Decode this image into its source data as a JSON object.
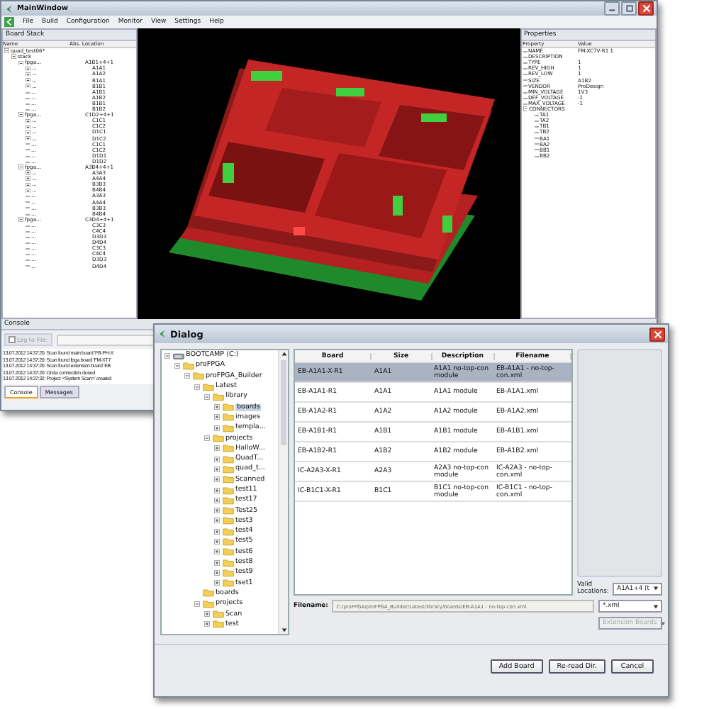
{
  "main_window": {
    "title": "MainWindow",
    "menu": [
      "File",
      "Build",
      "Configuration",
      "Monitor",
      "View",
      "Settings",
      "Help"
    ],
    "board_stack": {
      "title": "Board Stack",
      "columns": [
        "Name",
        "Abs. Location"
      ],
      "tree": [
        {
          "name": "quad_test06*",
          "expanded": true,
          "children": [
            {
              "name": "stack",
              "expanded": true,
              "children": [
                {
                  "name": "fpga...",
                  "location": "A1B1+4+1",
                  "expanded": true,
                  "children": [
                    {
                      "name": "...",
                      "location": "A1A1",
                      "expanded": false
                    },
                    {
                      "name": "...",
                      "location": "A1A2",
                      "expanded": false
                    },
                    {
                      "name": "...",
                      "location": "B1A1",
                      "expanded": false
                    },
                    {
                      "name": "...",
                      "location": "B1B1",
                      "expanded": false
                    },
                    {
                      "name": "...",
                      "location": "A1B1"
                    },
                    {
                      "name": "...",
                      "location": "A1B2"
                    },
                    {
                      "name": "...",
                      "location": "B1B1"
                    },
                    {
                      "name": "...",
                      "location": "B1B2"
                    }
                  ]
                },
                {
                  "name": "fpga...",
                  "location": "C1D2+4+1",
                  "expanded": true,
                  "children": [
                    {
                      "name": "...",
                      "location": "C1C1",
                      "expanded": false
                    },
                    {
                      "name": "...",
                      "location": "C1C2",
                      "expanded": false
                    },
                    {
                      "name": "...",
                      "location": "D1C1",
                      "expanded": false
                    },
                    {
                      "name": "...",
                      "location": "D1C2",
                      "expanded": false
                    },
                    {
                      "name": "...",
                      "location": "C1C1"
                    },
                    {
                      "name": "...",
                      "location": "C1C2"
                    },
                    {
                      "name": "...",
                      "location": "D1D1"
                    },
                    {
                      "name": "...",
                      "location": "D1D2"
                    }
                  ]
                },
                {
                  "name": "fpga...",
                  "location": "A3B4+4+1",
                  "expanded": true,
                  "children": [
                    {
                      "name": "...",
                      "location": "A3A3",
                      "expanded": false
                    },
                    {
                      "name": "...",
                      "location": "A4A4",
                      "expanded": false
                    },
                    {
                      "name": "...",
                      "location": "B3B3",
                      "expanded": false
                    },
                    {
                      "name": "...",
                      "location": "B4B4",
                      "expanded": false
                    },
                    {
                      "name": "...",
                      "location": "A3A3"
                    },
                    {
                      "name": "...",
                      "location": "A4A4"
                    },
                    {
                      "name": "...",
                      "location": "B3B3"
                    },
                    {
                      "name": "...",
                      "location": "B4B4"
                    }
                  ]
                },
                {
                  "name": "fpga...",
                  "location": "C3D4+4+1",
                  "expanded": true,
                  "children": [
                    {
                      "name": "...",
                      "location": "C3C3"
                    },
                    {
                      "name": "...",
                      "location": "C4C4"
                    },
                    {
                      "name": "...",
                      "location": "D3D3"
                    },
                    {
                      "name": "...",
                      "location": "D4D4"
                    },
                    {
                      "name": "...",
                      "location": "C3C3"
                    },
                    {
                      "name": "...",
                      "location": "C4C4"
                    },
                    {
                      "name": "...",
                      "location": "D3D3"
                    },
                    {
                      "name": "...",
                      "location": "D4D4"
                    }
                  ]
                }
              ]
            }
          ]
        }
      ]
    },
    "properties": {
      "title": "Properties",
      "columns": [
        "Property",
        "Value"
      ],
      "rows": [
        {
          "name": "NAME",
          "value": "FM-XC7V-R1 1"
        },
        {
          "name": "DESCRIPTION"
        },
        {
          "name": "TYPE",
          "value": "1"
        },
        {
          "name": "REV_HIGH",
          "value": "1"
        },
        {
          "name": "REV_LOW",
          "value": "1"
        },
        {
          "name": "SIZE",
          "value": "A1B2"
        },
        {
          "name": "VENDOR",
          "value": "ProDesign"
        },
        {
          "name": "MIN_VOLTAGE",
          "value": "1V3"
        },
        {
          "name": "DEF_VOLTAGE",
          "value": "-1"
        },
        {
          "name": "MAX_VOLTAGE",
          "value": "-1"
        },
        {
          "name": "CONNECTORS",
          "expanded": true,
          "children": [
            "TA1",
            "TA2",
            "TB1",
            "TB2",
            "BA1",
            "BA2",
            "BB1",
            "BB2"
          ]
        }
      ]
    },
    "console": {
      "title": "Console",
      "log_to_file": {
        "label": "Log to File:",
        "checked": false,
        "disabled": true
      },
      "lines": [
        "13.07.2012 14:37:20: Scan found main board 'FB-PH-X",
        "13.07.2012 14:37:20: Scan found fpga board 'FM-XT7",
        "13.07.2012 14:37:20: Scan found extension board 'EB",
        "13.07.2012 14:37:20: Onda connection closed",
        "13.07.2012 14:37:32: Project '<System Scan>' created"
      ],
      "tabs": [
        {
          "label": "Console",
          "selected": true
        },
        {
          "label": "Messages",
          "selected": false
        }
      ]
    }
  },
  "dialog": {
    "title": "Dialog",
    "tree": [
      {
        "name": "BOOTCAMP (C:)",
        "kind": "drive",
        "expanded": true,
        "selected": false,
        "children": [
          {
            "name": "proFPGA",
            "kind": "folder",
            "expanded": true,
            "selected": false,
            "children": [
              {
                "name": "proFPGA_Builder",
                "kind": "folder",
                "expanded": true,
                "selected": false,
                "children": [
                  {
                    "name": "Latest",
                    "kind": "folder",
                    "expanded": true,
                    "selected": false,
                    "children": [
                      {
                        "name": "library",
                        "kind": "folder",
                        "expanded": true,
                        "selected": false,
                        "children": [
                          {
                            "name": "boards",
                            "kind": "folder",
                            "expanded": false,
                            "selected": true
                          },
                          {
                            "name": "images",
                            "kind": "folder",
                            "expanded": false,
                            "selected": false
                          },
                          {
                            "name": "templa...",
                            "kind": "folder",
                            "expanded": false,
                            "selected": false
                          }
                        ]
                      },
                      {
                        "name": "projects",
                        "kind": "folder",
                        "expanded": true,
                        "selected": false,
                        "children": [
                          {
                            "name": "HalloW...",
                            "kind": "folder",
                            "expanded": false,
                            "selected": false
                          },
                          {
                            "name": "QuadT...",
                            "kind": "folder",
                            "expanded": false,
                            "selected": false
                          },
                          {
                            "name": "quad_t...",
                            "kind": "folder",
                            "expanded": false,
                            "selected": false
                          },
                          {
                            "name": "Scanned",
                            "kind": "folder",
                            "expanded": false,
                            "selected": false
                          },
                          {
                            "name": "test11",
                            "kind": "folder",
                            "expanded": false,
                            "selected": false
                          },
                          {
                            "name": "test17",
                            "kind": "folder",
                            "expanded": false,
                            "selected": false
                          },
                          {
                            "name": "Test25",
                            "kind": "folder",
                            "expanded": false,
                            "selected": false
                          },
                          {
                            "name": "test3",
                            "kind": "folder",
                            "expanded": false,
                            "selected": false
                          },
                          {
                            "name": "test4",
                            "kind": "folder",
                            "expanded": false,
                            "selected": false
                          },
                          {
                            "name": "test5",
                            "kind": "folder",
                            "expanded": false,
                            "selected": false
                          },
                          {
                            "name": "test6",
                            "kind": "folder",
                            "expanded": false,
                            "selected": false
                          },
                          {
                            "name": "test8",
                            "kind": "folder",
                            "expanded": false,
                            "selected": false
                          },
                          {
                            "name": "test9",
                            "kind": "folder",
                            "expanded": false,
                            "selected": false
                          },
                          {
                            "name": "tset1",
                            "kind": "folder",
                            "expanded": false,
                            "selected": false
                          }
                        ]
                      }
                    ]
                  },
                  {
                    "name": "boards",
                    "kind": "folder",
                    "selected": false
                  },
                  {
                    "name": "projects",
                    "kind": "folder",
                    "expanded": true,
                    "selected": false,
                    "children": [
                      {
                        "name": "Scan",
                        "kind": "folder",
                        "expanded": false,
                        "selected": false
                      },
                      {
                        "name": "test",
                        "kind": "folder",
                        "expanded": false,
                        "selected": false
                      }
                    ]
                  }
                ]
              }
            ]
          }
        ]
      }
    ],
    "table": {
      "columns": [
        "Board",
        "Size",
        "Description",
        "Filename"
      ],
      "rows": [
        {
          "board": "EB-A1A1-X-R1",
          "size": "A1A1",
          "description": "A1A1 no-top-con module",
          "filename": "EB-A1A1 - no-top-con.xml",
          "selected": true
        },
        {
          "board": "EB-A1A1-R1",
          "size": "A1A1",
          "description": "A1A1 module",
          "filename": "EB-A1A1.xml",
          "selected": false
        },
        {
          "board": "EB-A1A2-R1",
          "size": "A1A2",
          "description": "A1A2 module",
          "filename": "EB-A1A2.xml",
          "selected": false
        },
        {
          "board": "EB-A1B1-R1",
          "size": "A1B1",
          "description": "A1B1 module",
          "filename": "EB-A1B1.xml",
          "selected": false
        },
        {
          "board": "EB-A1B2-R1",
          "size": "A1B2",
          "description": "A1B2 module",
          "filename": "EB-A1B2.xml",
          "selected": false
        },
        {
          "board": "IC-A2A3-X-R1",
          "size": "A2A3",
          "description": "A2A3 no-top-con module",
          "filename": "IC-A2A3 - no-top-con.xml",
          "selected": false
        },
        {
          "board": "IC-B1C1-X-R1",
          "size": "B1C1",
          "description": "B1C1 no-top-con module",
          "filename": "IC-B1C1 - no-top-con.xml",
          "selected": false
        }
      ]
    },
    "valid_locations": {
      "label": "Valid Locations:",
      "value": "A1A1+4 (t"
    },
    "filename": {
      "label": "Filename:",
      "value": "C:/proFPGA/proFPGA_Builder/Latest/library/boards/EB-A1A1 - no-top-con.xml",
      "disabled": true
    },
    "filter": {
      "value": "*.xml"
    },
    "board_type": {
      "value": "Extension Boards",
      "disabled": true
    },
    "buttons": [
      "Add Board",
      "Re-read Dir.",
      "Cancel"
    ]
  }
}
